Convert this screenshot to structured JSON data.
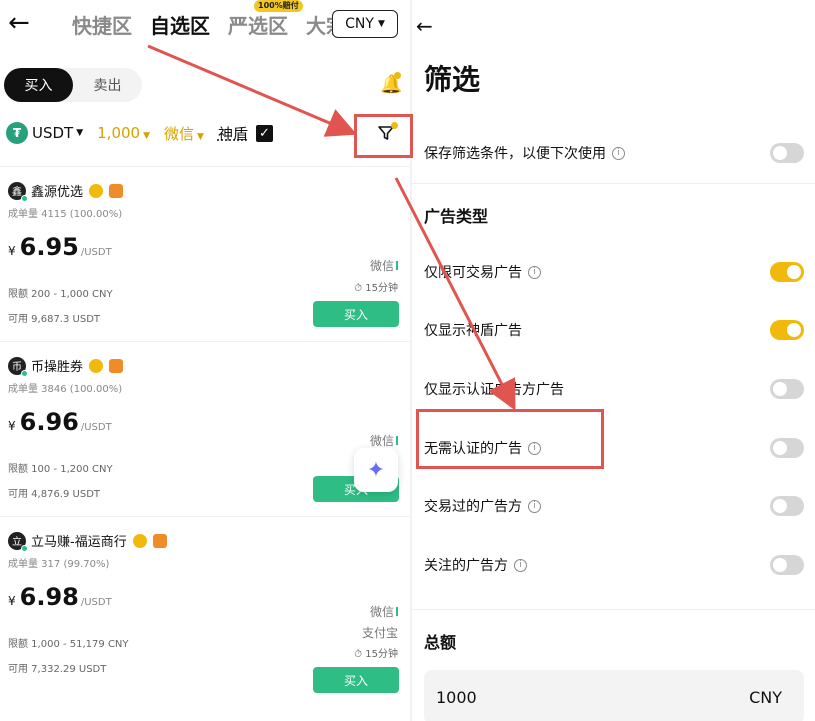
{
  "left": {
    "back_icon": "arrow-left-icon",
    "tabs": [
      {
        "label": "快捷区",
        "active": false
      },
      {
        "label": "自选区",
        "active": true
      },
      {
        "label": "严选区",
        "active": false,
        "badge": "100%赔付"
      },
      {
        "label": "大宗",
        "active": false
      }
    ],
    "currency": "CNY",
    "side_tabs": {
      "buy": "买入",
      "sell": "卖出"
    },
    "filters": {
      "coin": "USDT",
      "amount": "1,000",
      "payment": "微信",
      "shield": "神盾"
    },
    "ads": [
      {
        "merchant": "鑫源优选",
        "avatar": "鑫",
        "stats": "成单量 4115 (100.00%)",
        "currency_symbol": "¥",
        "price": "6.95",
        "unit": "/USDT",
        "limit": "限额 200 - 1,000 CNY",
        "available": "可用 9,687.3 USDT",
        "payments": [
          "微信"
        ],
        "time": "15分钟",
        "buy_label": "买入"
      },
      {
        "merchant": "币操胜券",
        "avatar": "币",
        "stats": "成单量 3846 (100.00%)",
        "currency_symbol": "¥",
        "price": "6.96",
        "unit": "/USDT",
        "limit": "限额 100 - 1,200 CNY",
        "available": "可用 4,876.9 USDT",
        "payments": [
          "微信"
        ],
        "time": "",
        "buy_label": "买入"
      },
      {
        "merchant": "立马赚-福运商行",
        "avatar": "立",
        "stats": "成单量 317 (99.70%)",
        "currency_symbol": "¥",
        "price": "6.98",
        "unit": "/USDT",
        "limit": "限额 1,000 - 51,179 CNY",
        "available": "可用 7,332.29 USDT",
        "payments": [
          "微信",
          "支付宝"
        ],
        "time": "15分钟",
        "buy_label": "买入"
      }
    ]
  },
  "right": {
    "back_icon": "arrow-left-icon",
    "title": "筛选",
    "save_filter": {
      "label": "保存筛选条件，以便下次使用",
      "on": false
    },
    "ad_type_title": "广告类型",
    "ad_type_options": [
      {
        "label": "仅限可交易广告",
        "on": true
      },
      {
        "label": "仅显示神盾广告",
        "on": true
      },
      {
        "label": "仅显示认证广告方广告",
        "on": false
      },
      {
        "label": "无需认证的广告",
        "on": false
      },
      {
        "label": "交易过的广告方",
        "on": false
      },
      {
        "label": "关注的广告方",
        "on": false
      }
    ],
    "amount_title": "总额",
    "amount_value": "1000",
    "amount_currency": "CNY"
  },
  "colors": {
    "accent": "#f0b90b",
    "buy_green": "#2ebd85",
    "annotation_red": "#e0554f"
  }
}
